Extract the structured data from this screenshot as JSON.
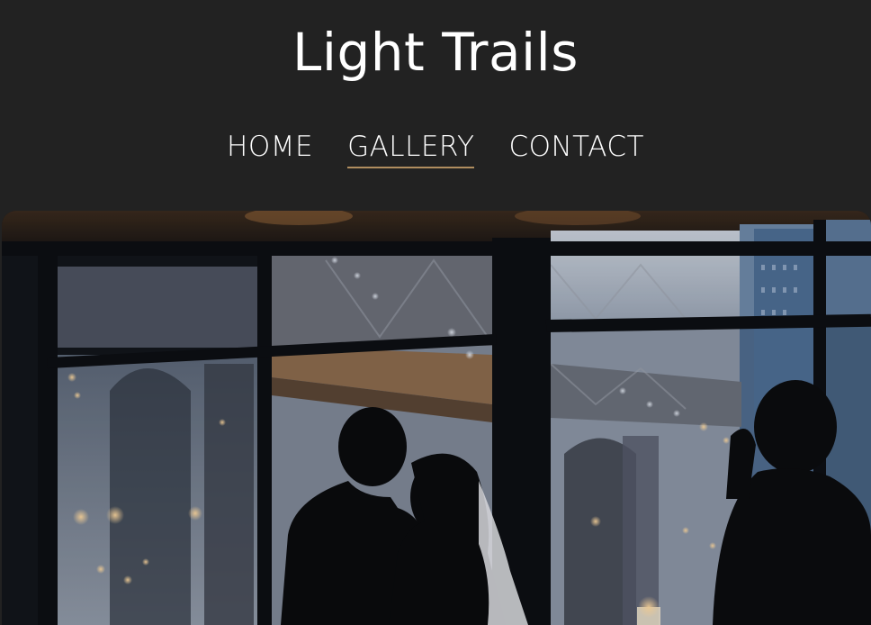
{
  "site": {
    "title": "Light Trails"
  },
  "nav": {
    "items": [
      {
        "label": "HOME",
        "active": false
      },
      {
        "label": "GALLERY",
        "active": true
      },
      {
        "label": "CONTACT",
        "active": false
      }
    ]
  },
  "colors": {
    "background": "#222222",
    "text": "#ffffff",
    "active_underline": "#b08d5f"
  },
  "hero": {
    "icon": "photo-wedding-dance-silhouette"
  }
}
